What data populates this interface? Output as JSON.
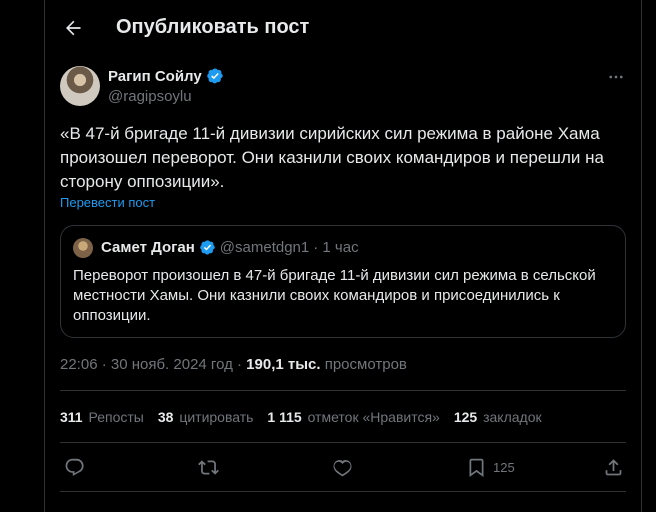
{
  "header": {
    "title": "Опубликовать пост"
  },
  "post": {
    "author_name": "Рагип Сойлу",
    "author_handle": "@ragipsoylu",
    "text": "«В 47-й бригаде 11-й дивизии сирийских сил режима в районе Хама произошел переворот. Они казнили своих командиров и перешли на сторону оппозиции».",
    "translate_label": "Перевести пост",
    "time": "22:06 · 30 нояб. 2024 год ·",
    "views_count": "190,1 тыс.",
    "views_label": "просмотров"
  },
  "quote": {
    "author_name": "Самет Доган",
    "author_handle": "@sametdgn1",
    "time": "· 1 час",
    "text": "Переворот произошел в 47-й бригаде 11-й дивизии сил режима в сельской местности Хамы. Они казнили своих командиров и присоединились к оппозиции."
  },
  "stats": {
    "reposts_count": "311",
    "reposts_label": "Репосты",
    "quotes_count": "38",
    "quotes_label": "цитировать",
    "likes_count": "1 115",
    "likes_label": "отметок «Нравится»",
    "bookmarks_count": "125",
    "bookmarks_label": "закладок"
  },
  "actions": {
    "bookmark_count": "125"
  },
  "colors": {
    "accent": "#1d9bf0",
    "muted": "#71767b",
    "text": "#e7e9ea",
    "border": "#2f3336",
    "background": "#000000"
  }
}
